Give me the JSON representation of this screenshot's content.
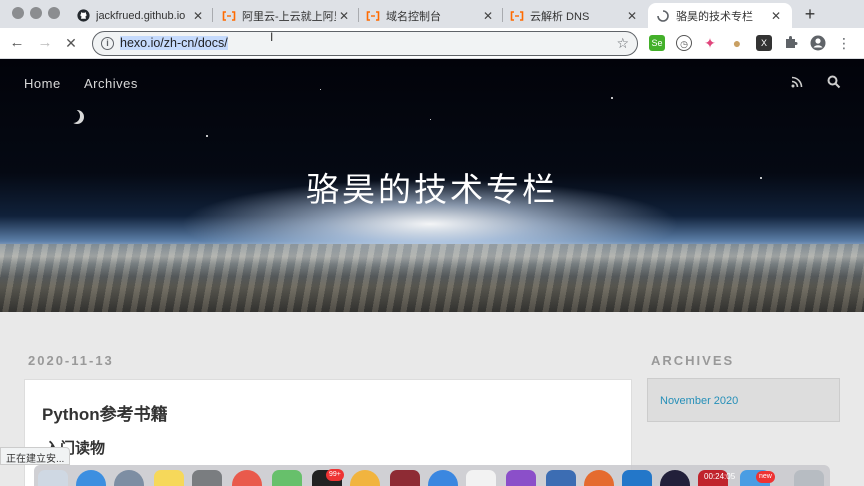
{
  "tabs": [
    {
      "title": "jackfrued.github.io",
      "favicon": "github-icon"
    },
    {
      "title": "阿里云-上云就上阿里云",
      "favicon": "aliyun-icon"
    },
    {
      "title": "域名控制台",
      "favicon": "aliyun-icon"
    },
    {
      "title": "云解析 DNS",
      "favicon": "aliyun-icon"
    },
    {
      "title": "骆昊的技术专栏",
      "favicon": "loading-spinner-icon",
      "active": true
    }
  ],
  "address_bar": {
    "url": "hexo.io/zh-cn/docs/"
  },
  "extensions": [
    {
      "name": "selenium-icon",
      "label": "Se",
      "color": "#43b02a"
    },
    {
      "name": "pomodoro-icon",
      "label": "◷",
      "color": "#6b6b6b"
    },
    {
      "name": "color-picker-icon",
      "label": "✦",
      "color": "#e0457b"
    },
    {
      "name": "cookie-icon",
      "label": "●",
      "color": "#c9a063"
    },
    {
      "name": "x-extension-icon",
      "label": "X",
      "color": "#333333"
    },
    {
      "name": "puzzle-icon",
      "label": "",
      "color": "#5f6368"
    },
    {
      "name": "profile-icon",
      "label": "",
      "color": "#5f6368"
    }
  ],
  "site": {
    "nav": [
      "Home",
      "Archives"
    ],
    "title": "骆昊的技术专栏"
  },
  "post": {
    "date": "2020-11-13",
    "title": "Python参考书籍",
    "heading": "入门读物"
  },
  "sidebar": {
    "title": "ARCHIVES",
    "items": [
      "November 2020"
    ]
  },
  "status_bar": "正在建立安...",
  "dock": {
    "badges": [
      "99+",
      "new"
    ],
    "clock": "00:24:05"
  }
}
